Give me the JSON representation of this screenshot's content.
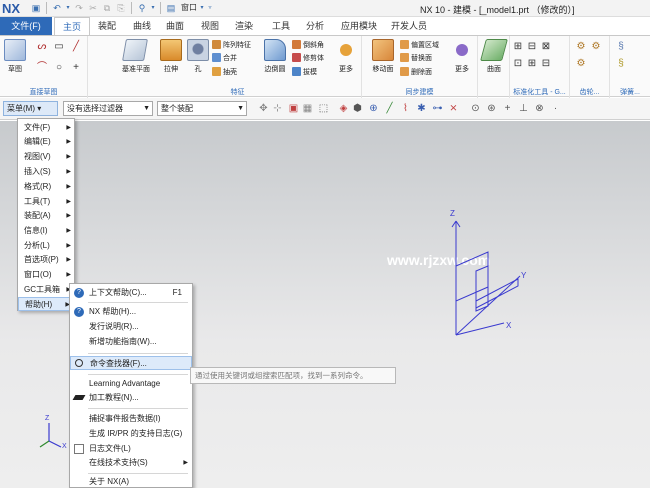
{
  "app": {
    "logo": "NX",
    "window_menu": "窗口",
    "title": "NX 10 - 建模 - [_model1.prt （修改的）]"
  },
  "tabs": {
    "file": "文件(F)",
    "items": [
      "主页",
      "装配",
      "曲线",
      "曲面",
      "视图",
      "渲染",
      "工具",
      "分析",
      "应用模块",
      "开发人员"
    ],
    "active": "主页"
  },
  "ribbon": {
    "sketch": {
      "label": "草图"
    },
    "direct_sketch_label": "直接草图",
    "datum_plane": {
      "label": "基准平面"
    },
    "extrude": {
      "label": "拉伸"
    },
    "hole": {
      "label": "孔"
    },
    "feature_small": {
      "pattern": "阵列特征",
      "unite": "合并",
      "shell": "抽壳"
    },
    "edge_blend": {
      "label": "边倒圆"
    },
    "feature_small2": {
      "chamfer": "倒斜角",
      "trim_body": "修剪体",
      "draft": "拔模"
    },
    "more1": {
      "label": "更多"
    },
    "feature_label": "特征",
    "move_face": {
      "label": "移动面"
    },
    "sync_small": {
      "offset_region": "偏置区域",
      "replace_face": "替换面",
      "delete_face": "删除面"
    },
    "more2": {
      "label": "更多"
    },
    "sync_label": "同步建模",
    "surface": {
      "label": "曲面"
    },
    "std_tools_label": "标准化工具 - G...",
    "gear_label": "齿轮...",
    "spring_label": "弹簧..."
  },
  "toolbar2": {
    "menu_button": "菜单(M)",
    "filter": "没有选择过滤器",
    "assembly_scope": "整个装配"
  },
  "watermark": "www.rjzxw.com",
  "menu_main": {
    "items": [
      {
        "label": "文件(F)"
      },
      {
        "label": "编辑(E)"
      },
      {
        "label": "视图(V)"
      },
      {
        "label": "插入(S)"
      },
      {
        "label": "格式(R)"
      },
      {
        "label": "工具(T)"
      },
      {
        "label": "装配(A)"
      },
      {
        "label": "信息(I)"
      },
      {
        "label": "分析(L)"
      },
      {
        "label": "首选项(P)"
      },
      {
        "label": "窗口(O)"
      },
      {
        "label": "GC工具箱"
      },
      {
        "label": "帮助(H)"
      }
    ]
  },
  "menu_help": {
    "items": [
      {
        "label": "上下文帮助(C)...",
        "shortcut": "F1"
      },
      {
        "label": "NX 帮助(H)..."
      },
      {
        "label": "发行说明(R)..."
      },
      {
        "label": "新增功能指南(W)..."
      },
      {
        "label": "命令查找器(F)..."
      },
      {
        "label": "Learning Advantage"
      },
      {
        "label": "加工教程(N)..."
      },
      {
        "label": "捕捉事件报告数据(I)"
      },
      {
        "label": "生成 IR/PR 的支持日志(G)"
      },
      {
        "label": "日志文件(L)"
      },
      {
        "label": "在线技术支持(S)"
      },
      {
        "label": "关于 NX(A)"
      }
    ]
  },
  "tooltip": "通过使用关键词或组搜索匹配项，找到一系列命令。",
  "triad": {
    "z": "Z",
    "y": "Y",
    "x": "X"
  },
  "mini_triad": {
    "z": "Z",
    "x": "X"
  },
  "colors": {
    "accent": "#2e6ab8",
    "highlight": "#ddeafa",
    "axis": "#4a3fd0"
  }
}
